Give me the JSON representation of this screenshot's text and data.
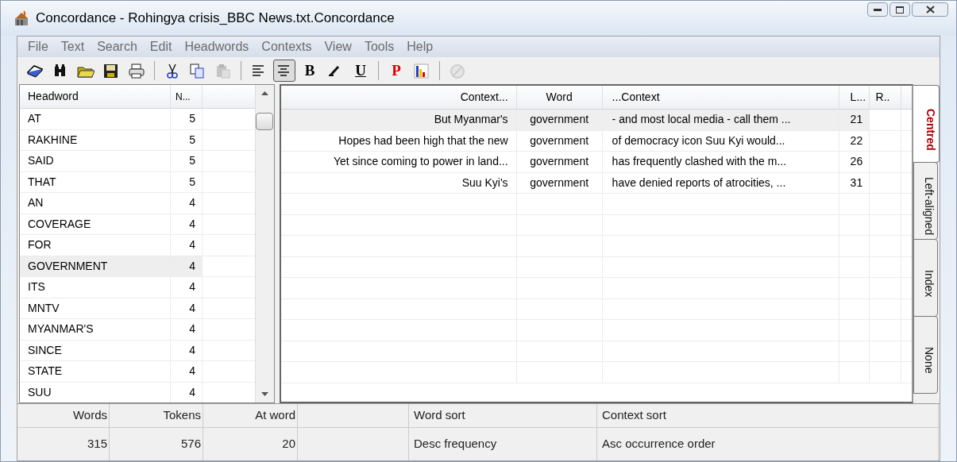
{
  "window": {
    "title": "Concordance - Rohingya crisis_BBC News.txt.Concordance"
  },
  "menu": [
    "File",
    "Text",
    "Search",
    "Edit",
    "Headwords",
    "Contexts",
    "View",
    "Tools",
    "Help"
  ],
  "toolbar": [
    {
      "kind": "icon",
      "pressed": false,
      "disabled": false
    },
    {
      "kind": "icon",
      "pressed": false,
      "disabled": false
    },
    {
      "kind": "icon",
      "pressed": false,
      "disabled": false
    },
    {
      "kind": "icon",
      "pressed": false,
      "disabled": false
    },
    {
      "kind": "icon",
      "pressed": false,
      "disabled": false
    },
    {
      "kind": "separator"
    },
    {
      "kind": "icon",
      "pressed": false,
      "disabled": false
    },
    {
      "kind": "icon",
      "pressed": false,
      "disabled": false
    },
    {
      "kind": "icon",
      "pressed": false,
      "disabled": true
    },
    {
      "kind": "separator"
    },
    {
      "kind": "icon",
      "pressed": false,
      "disabled": false
    },
    {
      "kind": "icon",
      "pressed": true,
      "disabled": false
    },
    {
      "kind": "text",
      "label": "B",
      "pressed": false,
      "disabled": false
    },
    {
      "kind": "icon",
      "pressed": false,
      "disabled": false
    },
    {
      "kind": "text",
      "label": "U",
      "pressed": false,
      "disabled": false
    },
    {
      "kind": "separator"
    },
    {
      "kind": "text",
      "label": "P",
      "pressed": false,
      "disabled": false
    },
    {
      "kind": "icon",
      "pressed": false,
      "disabled": false
    },
    {
      "kind": "separator"
    },
    {
      "kind": "icon",
      "pressed": false,
      "disabled": true
    }
  ],
  "headwords": {
    "columns": [
      "Headword",
      "N..."
    ],
    "rows": [
      {
        "word": "AT",
        "count": "5",
        "selected": false
      },
      {
        "word": "RAKHINE",
        "count": "5",
        "selected": false
      },
      {
        "word": "SAID",
        "count": "5",
        "selected": false
      },
      {
        "word": "THAT",
        "count": "5",
        "selected": false
      },
      {
        "word": "AN",
        "count": "4",
        "selected": false
      },
      {
        "word": "COVERAGE",
        "count": "4",
        "selected": false
      },
      {
        "word": "FOR",
        "count": "4",
        "selected": false
      },
      {
        "word": "GOVERNMENT",
        "count": "4",
        "selected": true
      },
      {
        "word": "ITS",
        "count": "4",
        "selected": false
      },
      {
        "word": "MNTV",
        "count": "4",
        "selected": false
      },
      {
        "word": "MYANMAR'S",
        "count": "4",
        "selected": false
      },
      {
        "word": "SINCE",
        "count": "4",
        "selected": false
      },
      {
        "word": "STATE",
        "count": "4",
        "selected": false
      },
      {
        "word": "SUU",
        "count": "4",
        "selected": false
      }
    ]
  },
  "concordance": {
    "columns": [
      "Context...",
      "Word",
      "...Context",
      "L...",
      "R.."
    ],
    "rows": [
      {
        "left": "But Myanmar's",
        "word": "government",
        "right": "- and most local media - call them ...",
        "line": "21",
        "selected": true
      },
      {
        "left": "Hopes had been high that the new",
        "word": "government",
        "right": "of democracy icon Suu Kyi would...",
        "line": "22",
        "selected": false
      },
      {
        "left": "Yet since coming to power in land...",
        "word": "government",
        "right": "has frequently clashed with the m...",
        "line": "26",
        "selected": false
      },
      {
        "left": "Suu Kyi's",
        "word": "government",
        "right": "have denied reports of atrocities, ...",
        "line": "31",
        "selected": false
      }
    ]
  },
  "view_tabs": [
    {
      "label": "Centred",
      "selected": true
    },
    {
      "label": "Left-aligned",
      "selected": false
    },
    {
      "label": "Index",
      "selected": false
    },
    {
      "label": "None",
      "selected": false
    }
  ],
  "status_bar": {
    "headers": [
      "Words",
      "Tokens",
      "At word",
      "Word sort",
      "Context sort"
    ],
    "values": [
      "315",
      "576",
      "20",
      "Desc frequency",
      "Asc occurrence order"
    ]
  }
}
